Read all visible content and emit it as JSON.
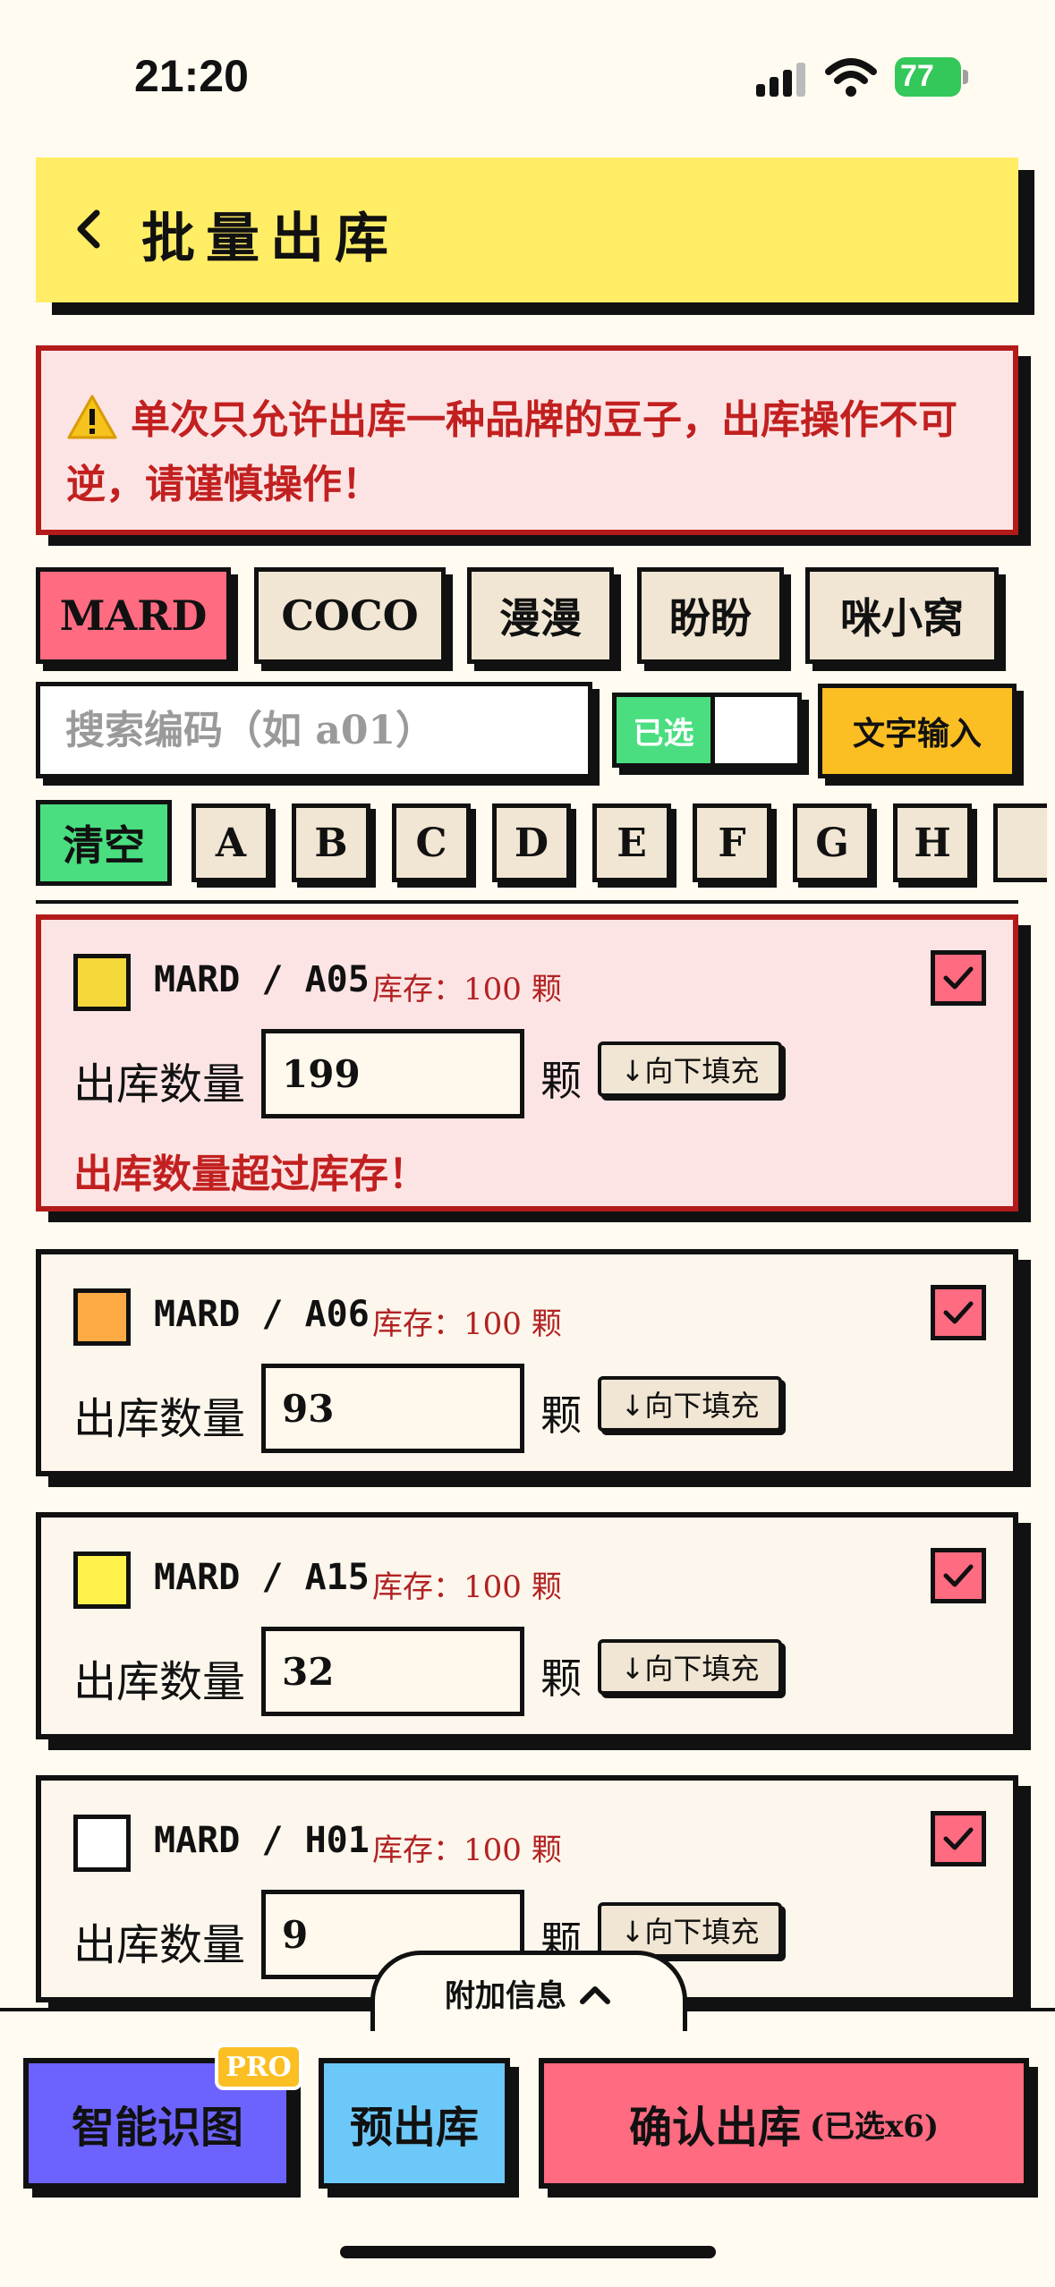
{
  "status": {
    "time": "21:20",
    "battery": "77"
  },
  "header": {
    "title": "批量出库"
  },
  "warning": {
    "text": "单次只允许出库一种品牌的豆子，出库操作不可逆，请谨慎操作！"
  },
  "brands": [
    "MARD",
    "COCO",
    "漫漫",
    "盼盼",
    "咪小窝"
  ],
  "search": {
    "placeholder": "搜索编码（如 a01）"
  },
  "toggle": {
    "label": "已选"
  },
  "text_input_label": "文字输入",
  "clear_label": "清空",
  "letters": [
    "A",
    "B",
    "C",
    "D",
    "E",
    "F",
    "G",
    "H"
  ],
  "items": [
    {
      "code": "MARD  /  A05",
      "stock": "库存：100 颗",
      "qty_label": "出库数量",
      "qty": "199",
      "unit": "颗",
      "fill_label": "↓向下填充",
      "error": "出库数量超过库存！",
      "color": "#f5d83a"
    },
    {
      "code": "MARD  /  A06",
      "stock": "库存：100 颗",
      "qty_label": "出库数量",
      "qty": "93",
      "unit": "颗",
      "fill_label": "↓向下填充",
      "color": "#ffab45"
    },
    {
      "code": "MARD  /  A15",
      "stock": "库存：100 颗",
      "qty_label": "出库数量",
      "qty": "32",
      "unit": "颗",
      "fill_label": "↓向下填充",
      "color": "#fff24a"
    },
    {
      "code": "MARD  /  H01",
      "stock": "库存：100 颗",
      "qty_label": "出库数量",
      "qty": "9",
      "unit": "颗",
      "fill_label": "↓向下填充",
      "color": "#ffffff"
    }
  ],
  "extra_info": "附加信息",
  "buttons": {
    "smart": "智能识图",
    "pro": "PRO",
    "pre": "预出库",
    "confirm": "确认出库",
    "confirm_sub": "(已选x6)"
  },
  "colors": {
    "accent": "#ff6b81",
    "header": "#ffed66",
    "green": "#4ade80",
    "yellow": "#fbbf24",
    "purple": "#6c63ff",
    "blue": "#6cc8f8"
  }
}
